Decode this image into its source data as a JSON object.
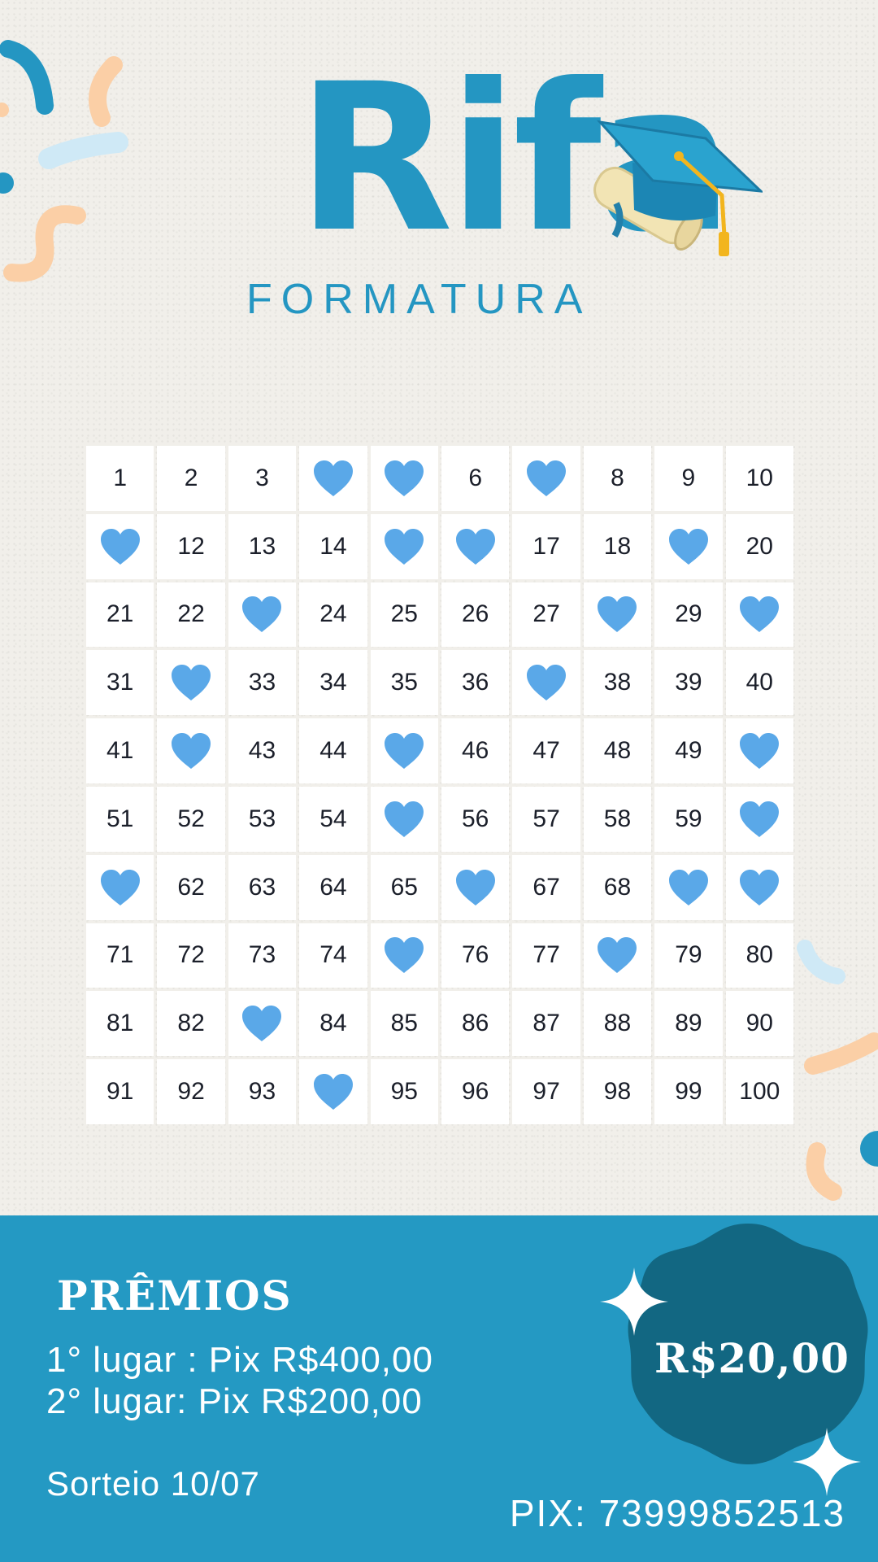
{
  "header": {
    "title": "Rifa",
    "subtitle": "FORMATURA"
  },
  "grid": {
    "columns": 10,
    "total": 100,
    "taken_icon": "heart-icon",
    "taken_numbers": [
      4,
      5,
      7,
      11,
      15,
      16,
      19,
      23,
      28,
      30,
      32,
      37,
      42,
      45,
      50,
      55,
      60,
      61,
      66,
      69,
      70,
      75,
      78,
      83,
      94
    ],
    "numbers": [
      "1",
      "2",
      "3",
      "4",
      "5",
      "6",
      "7",
      "8",
      "9",
      "10",
      "11",
      "12",
      "13",
      "14",
      "15",
      "16",
      "17",
      "18",
      "19",
      "20",
      "21",
      "22",
      "23",
      "24",
      "25",
      "26",
      "27",
      "28",
      "29",
      "30",
      "31",
      "32",
      "33",
      "34",
      "35",
      "36",
      "37",
      "38",
      "39",
      "40",
      "41",
      "42",
      "43",
      "44",
      "45",
      "46",
      "47",
      "48",
      "49",
      "50",
      "51",
      "52",
      "53",
      "54",
      "55",
      "56",
      "57",
      "58",
      "59",
      "60",
      "61",
      "62",
      "63",
      "64",
      "65",
      "66",
      "67",
      "68",
      "69",
      "70",
      "71",
      "72",
      "73",
      "74",
      "75",
      "76",
      "77",
      "78",
      "79",
      "80",
      "81",
      "82",
      "83",
      "84",
      "85",
      "86",
      "87",
      "88",
      "89",
      "90",
      "91",
      "92",
      "93",
      "94",
      "95",
      "96",
      "97",
      "98",
      "99",
      "100"
    ]
  },
  "prizes": {
    "title": "PRÊMIOS",
    "first": "1° lugar : Pix R$400,00",
    "second": "2° lugar: Pix R$200,00"
  },
  "draw_date": "Sorteio 10/07",
  "price": "R$20,00",
  "pix": "PIX: 73999852513",
  "colors": {
    "primary_blue": "#2499c3",
    "dark_blue": "#126782",
    "heart_blue": "#5aa8e8",
    "background": "#f1efea",
    "confetti_peach": "#fbcfa6",
    "confetti_light_blue": "#cfe9f6"
  }
}
